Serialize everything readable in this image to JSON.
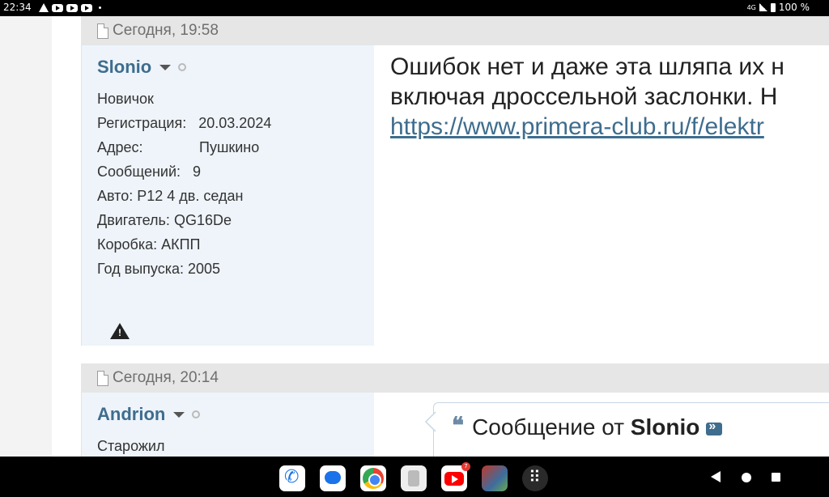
{
  "status_bar": {
    "time": "22:34",
    "network": "4G",
    "battery": "100 %"
  },
  "posts": [
    {
      "date": "Сегодня, 19:58",
      "user": {
        "name": "Slonio",
        "rank": "Новичок",
        "fields": [
          {
            "label": "Регистрация:",
            "value": "20.03.2024"
          },
          {
            "label": "Адрес:",
            "value": "Пушкино"
          },
          {
            "label": "Сообщений:",
            "value": "9"
          },
          {
            "label": "Авто:",
            "value": "P12 4 дв. седан"
          },
          {
            "label": "Двигатель:",
            "value": "QG16De"
          },
          {
            "label": "Коробка:",
            "value": "АКПП"
          },
          {
            "label": "Год выпуска:",
            "value": "2005"
          }
        ]
      },
      "content": {
        "line1": "Ошибок нет и даже эта шляпа их н",
        "line2": "включая дроссельной заслонки. Н",
        "link": "https://www.primera-club.ru/f/elektr"
      }
    },
    {
      "date": "Сегодня, 20:14",
      "user": {
        "name": "Andrion",
        "rank": "Старожил"
      },
      "quote": {
        "prefix": "Сообщение от",
        "author": "Slonio"
      }
    }
  ],
  "dock": {
    "youtube_badge": "7"
  }
}
